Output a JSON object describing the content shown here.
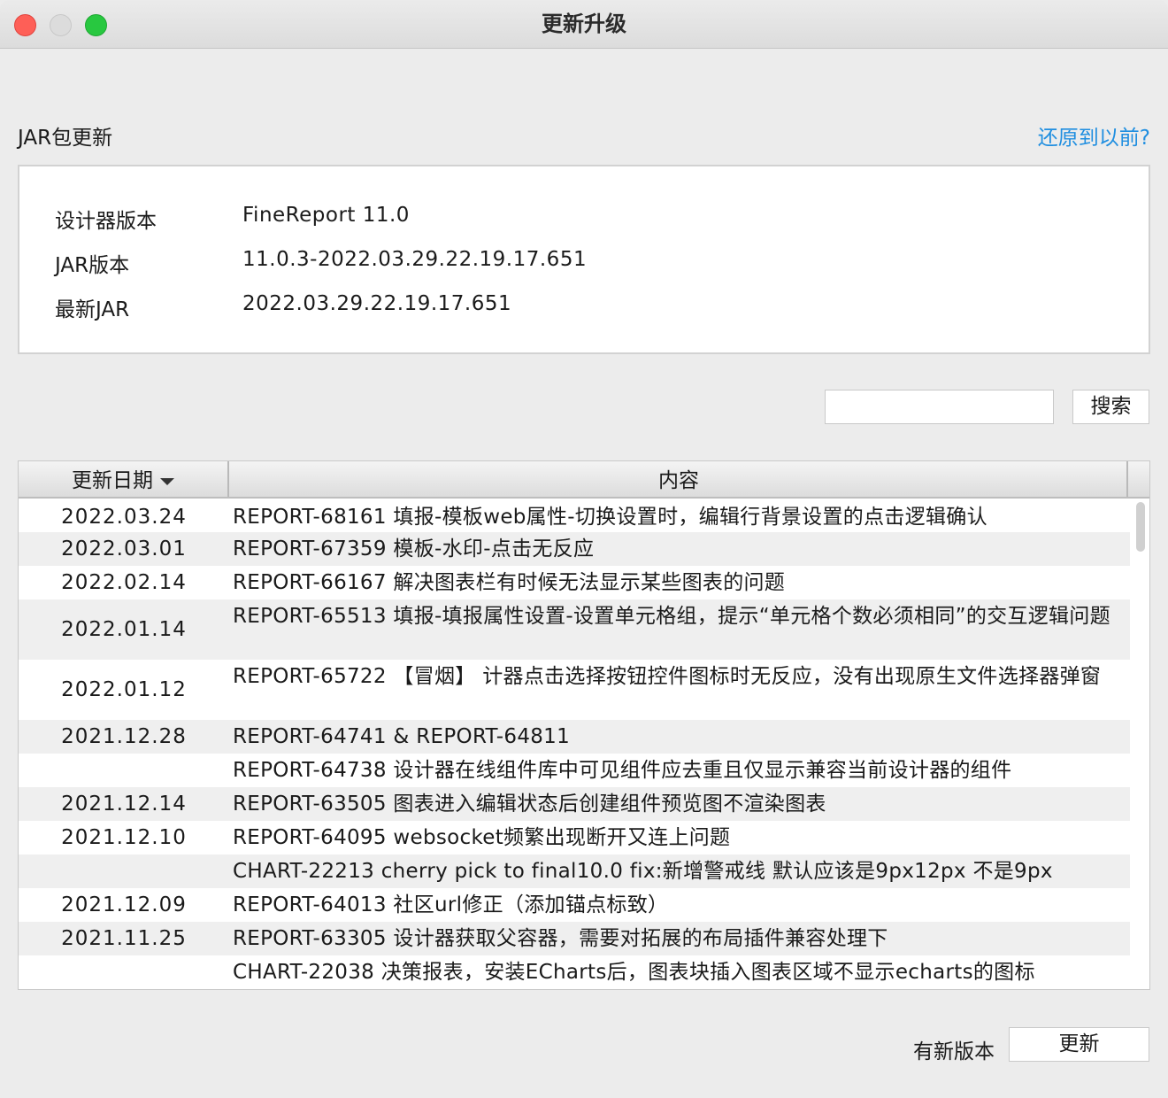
{
  "window": {
    "title": "更新升级"
  },
  "section": {
    "label": "JAR包更新",
    "restore_link": "还原到以前?"
  },
  "info": [
    {
      "key": "设计器版本",
      "value": "FineReport 11.0"
    },
    {
      "key": "JAR版本",
      "value": "11.0.3-2022.03.29.22.19.17.651"
    },
    {
      "key": "最新JAR",
      "value": "2022.03.29.22.19.17.651"
    }
  ],
  "search": {
    "value": "",
    "placeholder": "",
    "button_label": "搜索"
  },
  "table": {
    "headers": {
      "date": "更新日期",
      "content": "内容"
    },
    "rows": [
      {
        "date": "2022.03.24",
        "content": "REPORT-68161 填报-模板web属性-切换设置时，编辑行背景设置的点击逻辑确认"
      },
      {
        "date": "2022.03.01",
        "content": "REPORT-67359 模板-水印-点击无反应"
      },
      {
        "date": "2022.02.14",
        "content": "REPORT-66167 解决图表栏有时候无法显示某些图表的问题"
      },
      {
        "date": "2022.01.14",
        "content": "REPORT-65513 填报-填报属性设置-设置单元格组，提示“单元格个数必须相同”的交互逻辑问题"
      },
      {
        "date": "2022.01.12",
        "content": "REPORT-65722 【冒烟】 计器点击选择按钮控件图标时无反应，没有出现原生文件选择器弹窗"
      },
      {
        "date": "2021.12.28",
        "content": "REPORT-64741 & REPORT-64811"
      },
      {
        "date": "",
        "content": "REPORT-64738 设计器在线组件库中可见组件应去重且仅显示兼容当前设计器的组件"
      },
      {
        "date": "2021.12.14",
        "content": "REPORT-63505 图表进入编辑状态后创建组件预览图不渲染图表"
      },
      {
        "date": "2021.12.10",
        "content": "REPORT-64095 websocket频繁出现断开又连上问题"
      },
      {
        "date": "",
        "content": "CHART-22213 cherry pick to final10.0 fix:新增警戒线 默认应该是9px12px 不是9px"
      },
      {
        "date": "2021.12.09",
        "content": "REPORT-64013 社区url修正（添加锚点标致）"
      },
      {
        "date": "2021.11.25",
        "content": "REPORT-63305 设计器获取父容器，需要对拓展的布局插件兼容处理下"
      },
      {
        "date": "",
        "content": "CHART-22038 决策报表，安装ECharts后，图表块插入图表区域不显示echarts的图标"
      }
    ]
  },
  "footer": {
    "status": "有新版本",
    "update_button": "更新"
  }
}
